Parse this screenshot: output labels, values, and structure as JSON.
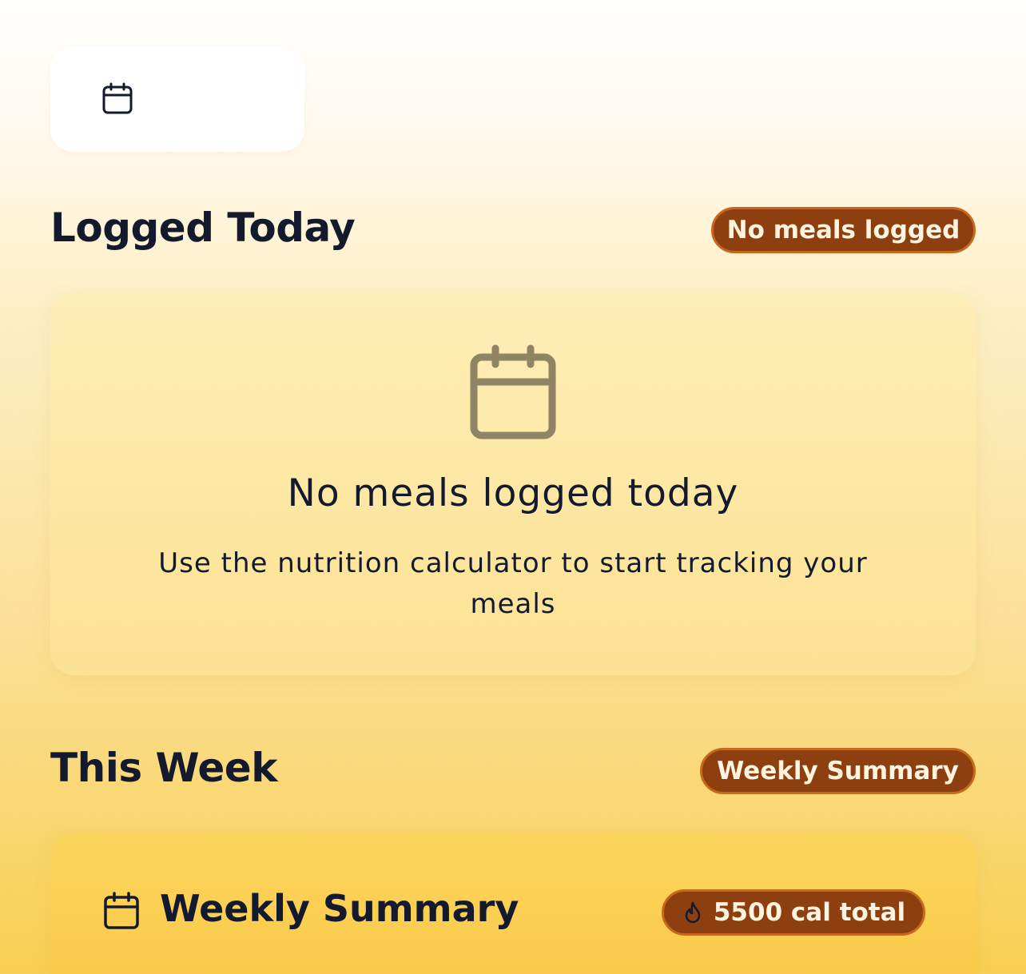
{
  "date_picker": {
    "icon": "calendar-icon"
  },
  "logged_today": {
    "title": "Logged Today",
    "badge": "No meals logged",
    "empty_state": {
      "icon": "calendar-icon",
      "title": "No meals logged today",
      "description": "Use the nutrition calculator to start tracking your meals"
    }
  },
  "this_week": {
    "title": "This Week",
    "badge": "Weekly Summary",
    "summary_card": {
      "icon": "calendar-icon",
      "title": "Weekly Summary",
      "calories_badge": {
        "icon": "flame-icon",
        "text": "5500 cal total"
      }
    }
  },
  "colors": {
    "badge_bg": "#8e3f0f",
    "badge_border": "#c9671d",
    "text_dark": "#141a2e"
  }
}
